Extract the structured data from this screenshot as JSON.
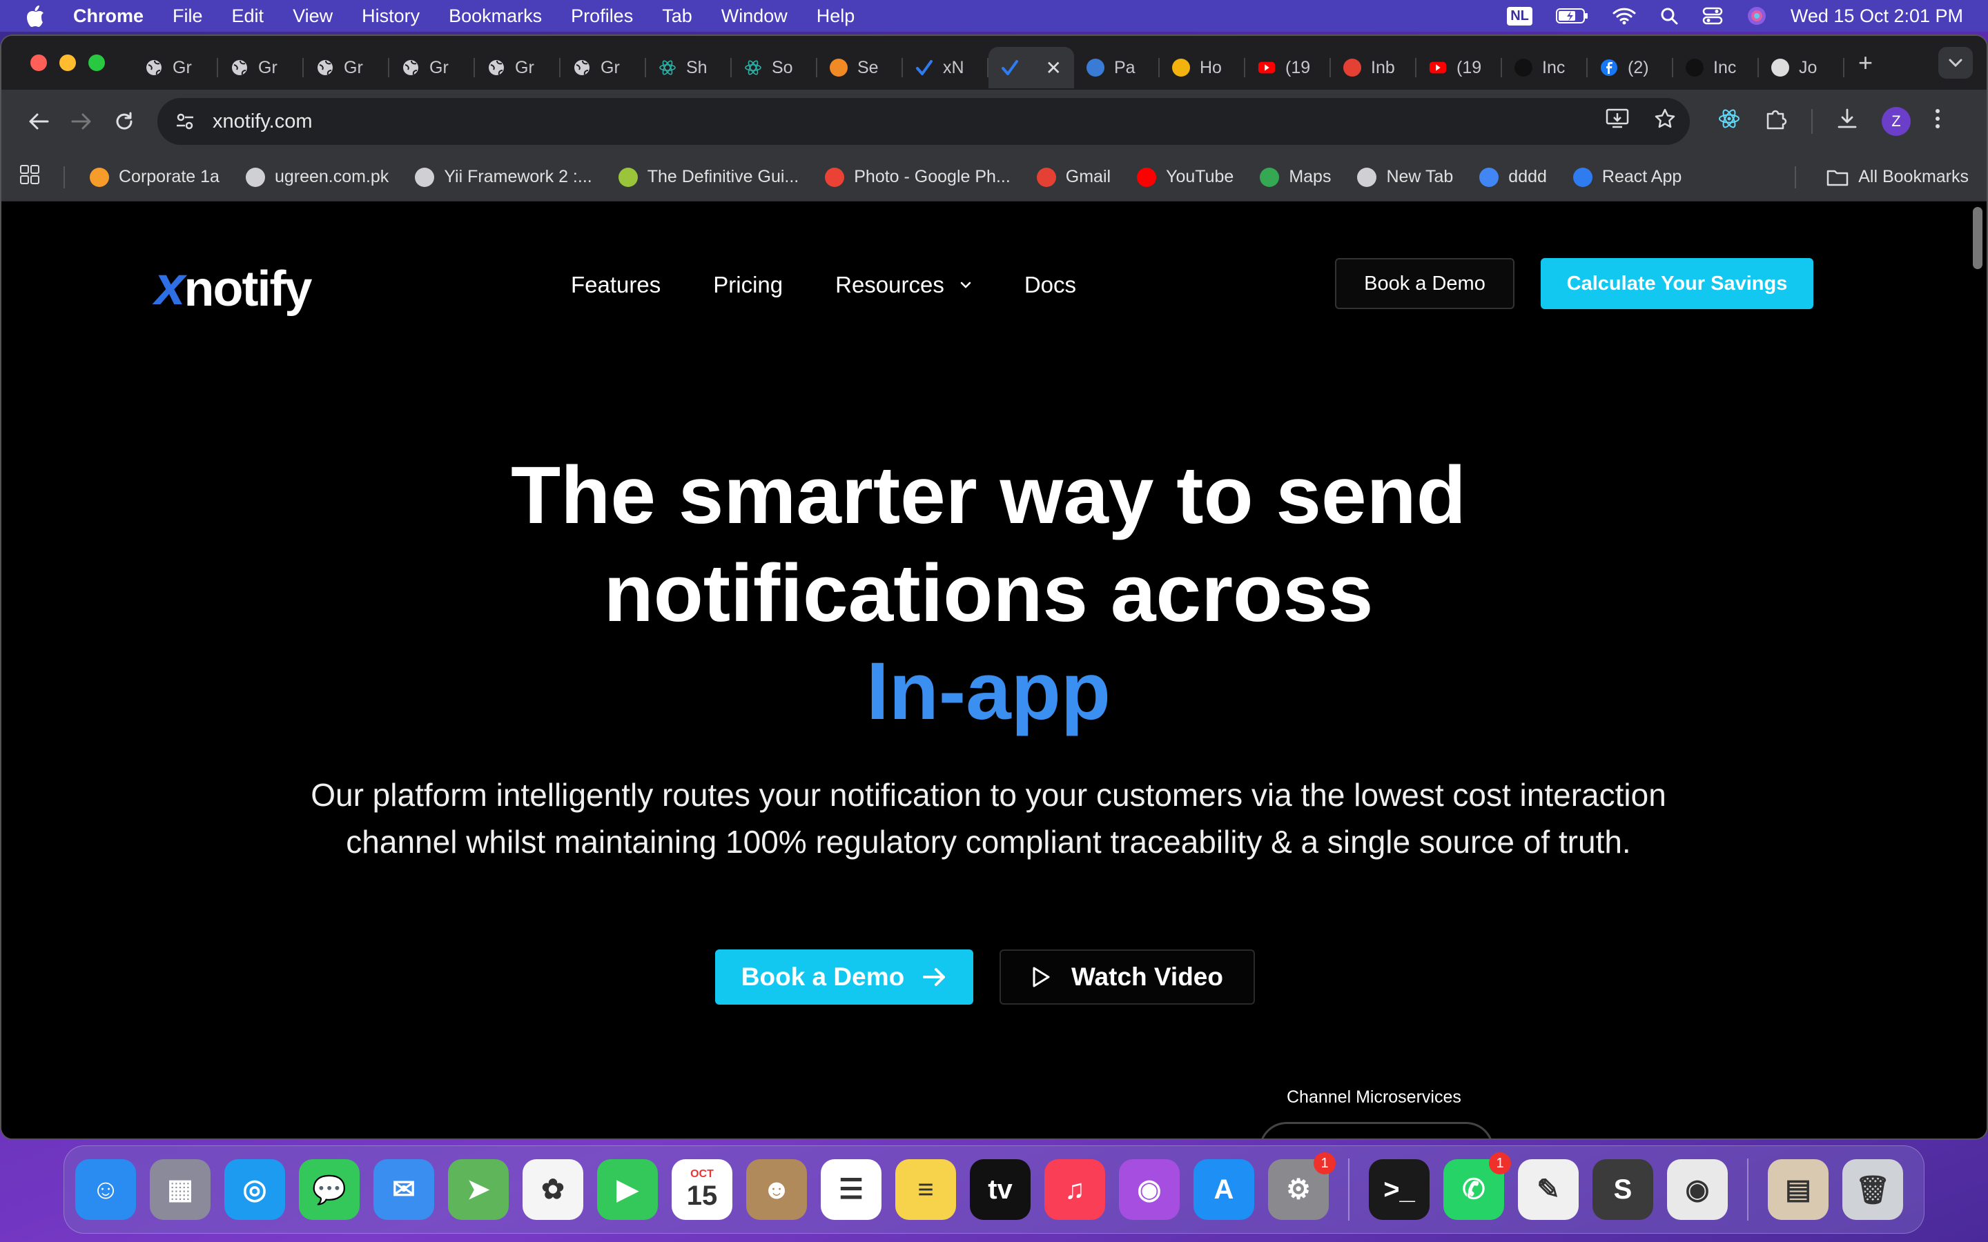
{
  "menubar": {
    "app": "Chrome",
    "items": [
      "File",
      "Edit",
      "View",
      "History",
      "Bookmarks",
      "Profiles",
      "Tab",
      "Window",
      "Help"
    ],
    "input_badge": "NL",
    "datetime": "Wed 15 Oct  2:01 PM"
  },
  "tabs": [
    {
      "title": "Gr",
      "icon": "globe-icon",
      "color": "#cfcfd4"
    },
    {
      "title": "Gr",
      "icon": "globe-icon",
      "color": "#cfcfd4"
    },
    {
      "title": "Gr",
      "icon": "globe-icon",
      "color": "#cfcfd4"
    },
    {
      "title": "Gr",
      "icon": "globe-icon",
      "color": "#cfcfd4"
    },
    {
      "title": "Gr",
      "icon": "globe-icon",
      "color": "#cfcfd4"
    },
    {
      "title": "Gr",
      "icon": "globe-icon",
      "color": "#cfcfd4"
    },
    {
      "title": "Sh",
      "icon": "react-icon",
      "color": "#2bb3a8"
    },
    {
      "title": "So",
      "icon": "react-icon",
      "color": "#2bb3a8"
    },
    {
      "title": "Se",
      "icon": "bolt-icon",
      "color": "#f08a24"
    },
    {
      "title": "xN",
      "icon": "check-icon",
      "color": "#2f7bf0"
    },
    {
      "title": "",
      "icon": "check-icon",
      "color": "#2f7bf0",
      "active": true
    },
    {
      "title": "Pa",
      "icon": "wifi-icon",
      "color": "#3a7bd5"
    },
    {
      "title": "Ho",
      "icon": "drive-icon",
      "color": "#f2b30f"
    },
    {
      "title": "(19",
      "icon": "youtube-icon",
      "color": "#ff0000"
    },
    {
      "title": "Inb",
      "icon": "gmail-icon",
      "color": "#e44134"
    },
    {
      "title": "(19",
      "icon": "youtube-icon",
      "color": "#ff0000"
    },
    {
      "title": "Inc",
      "icon": "dot-icon",
      "color": "#111111"
    },
    {
      "title": "(2)",
      "icon": "facebook-icon",
      "color": "#1877f2"
    },
    {
      "title": "Inc",
      "icon": "dot-icon",
      "color": "#111111"
    },
    {
      "title": "Jo",
      "icon": "openai-icon",
      "color": "#dddddd"
    }
  ],
  "address": {
    "url": "xnotify.com"
  },
  "bookmarks": [
    {
      "label": "Corporate 1a",
      "color": "#f59c2b"
    },
    {
      "label": "ugreen.com.pk",
      "color": "#cfcfd4"
    },
    {
      "label": "Yii Framework 2 :...",
      "color": "#cfcfd4"
    },
    {
      "label": "The Definitive Gui...",
      "color": "#9ac43a"
    },
    {
      "label": "Photo - Google Ph...",
      "color": "#ea4335"
    },
    {
      "label": "Gmail",
      "color": "#e44134"
    },
    {
      "label": "YouTube",
      "color": "#ff0000"
    },
    {
      "label": "Maps",
      "color": "#34a853"
    },
    {
      "label": "New Tab",
      "color": "#cfcfd4"
    },
    {
      "label": "dddd",
      "color": "#4285f4"
    },
    {
      "label": "React App",
      "color": "#2f7bf0"
    }
  ],
  "bookmarks_all": "All Bookmarks",
  "site": {
    "logo_x": "x",
    "logo_rest": "notify",
    "nav": {
      "features": "Features",
      "pricing": "Pricing",
      "resources": "Resources",
      "docs": "Docs"
    },
    "book_demo": "Book a Demo",
    "calculate": "Calculate Your Savings",
    "hero_line1": "The smarter way to send",
    "hero_line2": "notifications across",
    "hero_accent": "In-app",
    "hero_sub": "Our platform intelligently routes your notification to your customers via the lowest cost interaction channel whilst maintaining 100% regulatory compliant traceability & a single source of truth.",
    "cta_demo": "Book a Demo",
    "cta_video": "Watch Video",
    "micro_label": "Channel Microservices",
    "accent_color": "#3b8ff0",
    "cta_color": "#12c8f0"
  },
  "dock": [
    {
      "name": "finder",
      "color": "#2a8cf0",
      "glyph": "☺"
    },
    {
      "name": "launchpad",
      "color": "#8a8a9a",
      "glyph": "▦"
    },
    {
      "name": "safari",
      "color": "#1d9bf0",
      "glyph": "◎"
    },
    {
      "name": "messages",
      "color": "#34c759",
      "glyph": "💬"
    },
    {
      "name": "mail",
      "color": "#3a8ef0",
      "glyph": "✉"
    },
    {
      "name": "maps",
      "color": "#5fb55a",
      "glyph": "➤"
    },
    {
      "name": "photos",
      "color": "#f5f5f5",
      "glyph": "✿"
    },
    {
      "name": "facetime",
      "color": "#34c759",
      "glyph": "▶"
    },
    {
      "name": "calendar",
      "color": "#ffffff",
      "glyph": "15",
      "label": "OCT"
    },
    {
      "name": "contacts",
      "color": "#b08a5a",
      "glyph": "☻"
    },
    {
      "name": "reminders",
      "color": "#ffffff",
      "glyph": "☰"
    },
    {
      "name": "notes",
      "color": "#f6d34a",
      "glyph": "≡"
    },
    {
      "name": "tv",
      "color": "#111111",
      "glyph": "tv"
    },
    {
      "name": "music",
      "color": "#fa3e55",
      "glyph": "♫"
    },
    {
      "name": "podcasts",
      "color": "#a64ee0",
      "glyph": "◉"
    },
    {
      "name": "app-store",
      "color": "#1e8ff5",
      "glyph": "A"
    },
    {
      "name": "system-settings",
      "color": "#8a8a8e",
      "glyph": "⚙",
      "badge": "1"
    },
    {
      "name": "terminal",
      "color": "#1a1a1a",
      "glyph": ">_"
    },
    {
      "name": "whatsapp",
      "color": "#25d366",
      "glyph": "✆",
      "badge": "1"
    },
    {
      "name": "textedit",
      "color": "#f0f0f0",
      "glyph": "✎"
    },
    {
      "name": "sublime-text",
      "color": "#3b3b3b",
      "glyph": "S"
    },
    {
      "name": "chrome",
      "color": "#e9e9e9",
      "glyph": "◉"
    },
    {
      "name": "downloads-stack",
      "color": "#d9c9b0",
      "glyph": "▤"
    },
    {
      "name": "trash",
      "color": "#cfd3d8",
      "glyph": "🗑"
    }
  ]
}
